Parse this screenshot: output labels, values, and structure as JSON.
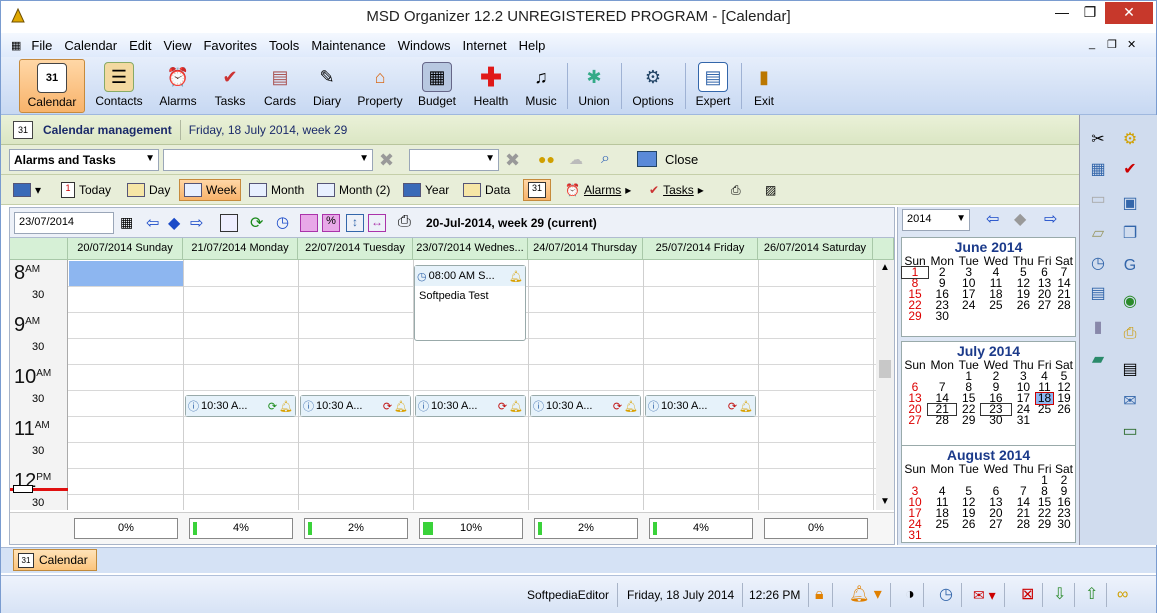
{
  "window": {
    "title": "MSD Organizer 12.2 UNREGISTERED PROGRAM - [Calendar]"
  },
  "menu": [
    "File",
    "Calendar",
    "Edit",
    "View",
    "Favorites",
    "Tools",
    "Maintenance",
    "Windows",
    "Internet",
    "Help"
  ],
  "toolbar": [
    {
      "label": "Calendar",
      "icon": "calendar-icon",
      "active": true
    },
    {
      "label": "Contacts",
      "icon": "contacts-icon"
    },
    {
      "label": "Alarms",
      "icon": "alarm-clock-icon"
    },
    {
      "label": "Tasks",
      "icon": "tasks-icon"
    },
    {
      "label": "Cards",
      "icon": "cards-icon"
    },
    {
      "label": "Diary",
      "icon": "diary-icon"
    },
    {
      "label": "Property",
      "icon": "house-icon"
    },
    {
      "label": "Budget",
      "icon": "calculator-icon"
    },
    {
      "label": "Health",
      "icon": "health-cross-icon"
    },
    {
      "label": "Music",
      "icon": "music-icon"
    },
    {
      "label": "Union",
      "icon": "union-icon"
    },
    {
      "label": "Options",
      "icon": "options-icon"
    },
    {
      "label": "Expert",
      "icon": "expert-icon"
    },
    {
      "label": "Exit",
      "icon": "exit-door-icon"
    }
  ],
  "management": {
    "title": "Calendar management",
    "date": "Friday, 18 July 2014, week 29"
  },
  "filters": {
    "category": "Alarms and Tasks",
    "close_label": "Close"
  },
  "views": [
    {
      "label": "Today",
      "icon": "today-icon"
    },
    {
      "label": "Day",
      "icon": "day-icon"
    },
    {
      "label": "Week",
      "icon": "week-icon",
      "active": true
    },
    {
      "label": "Month",
      "icon": "month-icon"
    },
    {
      "label": "Month (2)",
      "icon": "month2-icon"
    },
    {
      "label": "Year",
      "icon": "year-icon"
    },
    {
      "label": "Data",
      "icon": "data-icon"
    }
  ],
  "extra_menus": {
    "alarms": "Alarms",
    "tasks": "Tasks"
  },
  "nav": {
    "date_input": "23/07/2014",
    "week_label": "20-Jul-2014, week 29 (current)"
  },
  "days": [
    {
      "header": "20/07/2014 Sunday",
      "progress": "0%",
      "fill": 0
    },
    {
      "header": "21/07/2014 Monday",
      "progress": "4%",
      "fill": 0.04
    },
    {
      "header": "22/07/2014 Tuesday",
      "progress": "2%",
      "fill": 0.02
    },
    {
      "header": "23/07/2014 Wednes...",
      "progress": "10%",
      "fill": 0.1
    },
    {
      "header": "24/07/2014 Thursday",
      "progress": "2%",
      "fill": 0.02
    },
    {
      "header": "25/07/2014 Friday",
      "progress": "4%",
      "fill": 0.04
    },
    {
      "header": "26/07/2014 Saturday",
      "progress": "0%",
      "fill": 0
    }
  ],
  "hours": [
    {
      "h": "8",
      "ampm": "AM",
      "half": "30"
    },
    {
      "h": "9",
      "ampm": "AM",
      "half": "30"
    },
    {
      "h": "10",
      "ampm": "AM",
      "half": "30"
    },
    {
      "h": "11",
      "ampm": "AM",
      "half": "30"
    },
    {
      "h": "12",
      "ampm": "PM",
      "half": "30"
    }
  ],
  "events": {
    "main": {
      "time": "08:00 AM S...",
      "text": "Softpedia Test"
    },
    "recurring": "10:30 A..."
  },
  "year_select": "2014",
  "mini_calendars": [
    {
      "title": "June 2014",
      "weekdays": [
        "Sun",
        "Mon",
        "Tue",
        "Wed",
        "Thu",
        "Fri",
        "Sat"
      ],
      "weeks": [
        [
          "1",
          "2",
          "3",
          "4",
          "5",
          "6",
          "7"
        ],
        [
          "8",
          "9",
          "10",
          "11",
          "12",
          "13",
          "14"
        ],
        [
          "15",
          "16",
          "17",
          "18",
          "19",
          "20",
          "21"
        ],
        [
          "22",
          "23",
          "24",
          "25",
          "26",
          "27",
          "28"
        ],
        [
          "29",
          "30",
          "",
          "",
          "",
          "",
          ""
        ]
      ]
    },
    {
      "title": "July 2014",
      "weekdays": [
        "Sun",
        "Mon",
        "Tue",
        "Wed",
        "Thu",
        "Fri",
        "Sat"
      ],
      "weeks": [
        [
          "",
          "",
          "1",
          "2",
          "3",
          "4",
          "5"
        ],
        [
          "6",
          "7",
          "8",
          "9",
          "10",
          "11",
          "12"
        ],
        [
          "13",
          "14",
          "15",
          "16",
          "17",
          "18",
          "19"
        ],
        [
          "20",
          "21",
          "22",
          "23",
          "24",
          "25",
          "26"
        ],
        [
          "27",
          "28",
          "29",
          "30",
          "31",
          "",
          ""
        ]
      ]
    },
    {
      "title": "August 2014",
      "weekdays": [
        "Sun",
        "Mon",
        "Tue",
        "Wed",
        "Thu",
        "Fri",
        "Sat"
      ],
      "weeks": [
        [
          "",
          "",
          "",
          "",
          "",
          "1",
          "2"
        ],
        [
          "3",
          "4",
          "5",
          "6",
          "7",
          "8",
          "9"
        ],
        [
          "10",
          "11",
          "12",
          "13",
          "14",
          "15",
          "16"
        ],
        [
          "17",
          "18",
          "19",
          "20",
          "21",
          "22",
          "23"
        ],
        [
          "24",
          "25",
          "26",
          "27",
          "28",
          "29",
          "30"
        ],
        [
          "31",
          "",
          "",
          "",
          "",
          "",
          ""
        ]
      ]
    }
  ],
  "tab": {
    "label": "Calendar"
  },
  "status": {
    "user": "SoftpediaEditor",
    "date": "Friday, 18 July 2014",
    "time": "12:26 PM"
  }
}
